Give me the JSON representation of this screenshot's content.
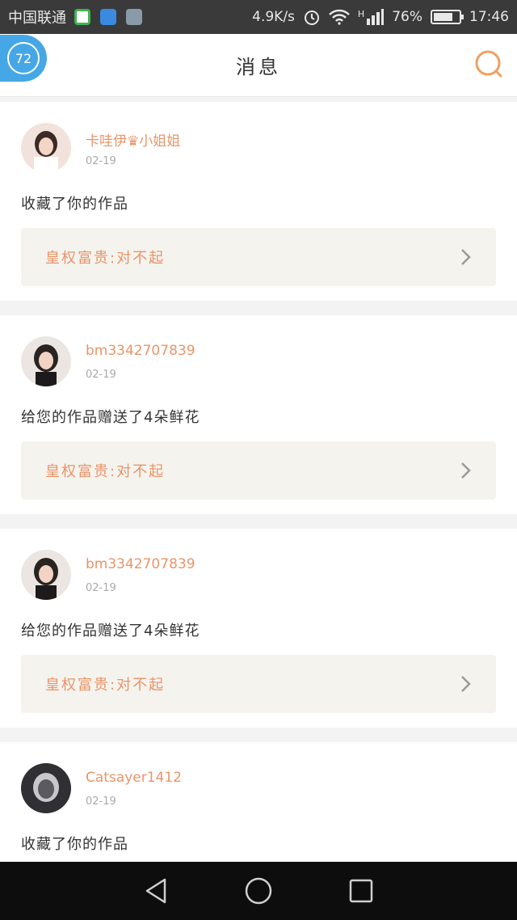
{
  "status_bar": {
    "carrier": "中国联通",
    "speed": "4.9K/s",
    "network": "H",
    "battery": "76%",
    "battery_level": 0.76,
    "time": "17:46"
  },
  "header": {
    "title": "消息",
    "badge_text": "72"
  },
  "notifications": [
    {
      "username": "卡哇伊♛小姐姐",
      "date": "02-19",
      "message": "收藏了你的作品",
      "work_title": "皇权富贵:对不起",
      "avatar_colors": [
        "#f1e3dc",
        "#3b2a25"
      ]
    },
    {
      "username": "bm3342707839",
      "date": "02-19",
      "message": "给您的作品赠送了4朵鲜花",
      "work_title": "皇权富贵:对不起",
      "avatar_colors": [
        "#ece6e2",
        "#2a2421"
      ]
    },
    {
      "username": "bm3342707839",
      "date": "02-19",
      "message": "给您的作品赠送了4朵鲜花",
      "work_title": "皇权富贵:对不起",
      "avatar_colors": [
        "#ece6e2",
        "#2a2421"
      ]
    },
    {
      "username": "Catsayer1412",
      "date": "02-19",
      "message": "收藏了你的作品",
      "work_title": "",
      "avatar_colors": [
        "#2f2f34",
        "#c7c7cc"
      ]
    }
  ],
  "colors": {
    "accent": "#e8956a",
    "badge": "#46a7e6",
    "search": "#f0a061"
  },
  "icons": {
    "back": "back-triangle-icon",
    "home": "home-circle-icon",
    "recents": "recents-square-icon",
    "search": "search-icon",
    "chevron": "chevron-right-icon"
  }
}
